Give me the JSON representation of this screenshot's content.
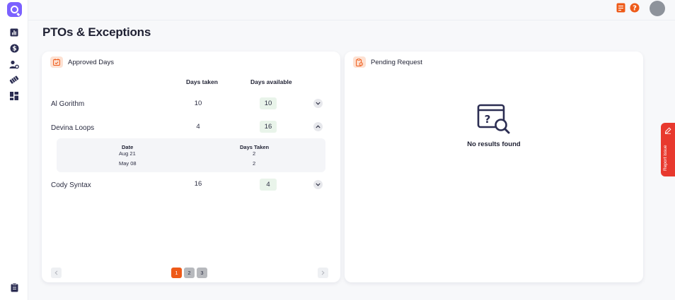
{
  "page": {
    "title": "PTOs & Exceptions"
  },
  "colors": {
    "accent": "#ee5a18",
    "brand": "#7b61ff",
    "available_bg": "#e9f4ea",
    "report": "#e8392e"
  },
  "sidebar": {
    "logo_icon": "q-logo-icon",
    "items": [
      {
        "icon": "bar-chart-icon"
      },
      {
        "icon": "dollar-icon"
      },
      {
        "icon": "user-settings-icon"
      },
      {
        "icon": "ticket-icon"
      },
      {
        "icon": "dashboard-grid-icon"
      }
    ],
    "bottom_icon": "clipboard-icon"
  },
  "topbar": {
    "icons": [
      "document-icon",
      "help-icon"
    ]
  },
  "approved": {
    "title": "Approved Days",
    "col_taken": "Days taken",
    "col_available": "Days available",
    "rows": [
      {
        "name": "Al Gorithm",
        "taken": "10",
        "available": "10",
        "expanded": false
      },
      {
        "name": "Devina Loops",
        "taken": "4",
        "available": "16",
        "expanded": true
      },
      {
        "name": "Cody Syntax",
        "taken": "16",
        "available": "4",
        "expanded": false
      }
    ],
    "detail": {
      "col_date": "Date",
      "col_taken": "Days Taken",
      "rows": [
        {
          "date": "Aug 21",
          "taken": "2"
        },
        {
          "date": "May 08",
          "taken": "2"
        }
      ]
    },
    "pagination": {
      "pages": [
        "1",
        "2",
        "3"
      ],
      "current": "1"
    }
  },
  "pending": {
    "title": "Pending Request",
    "empty_text": "No results found"
  },
  "report_issue": {
    "label": "Report issue"
  }
}
